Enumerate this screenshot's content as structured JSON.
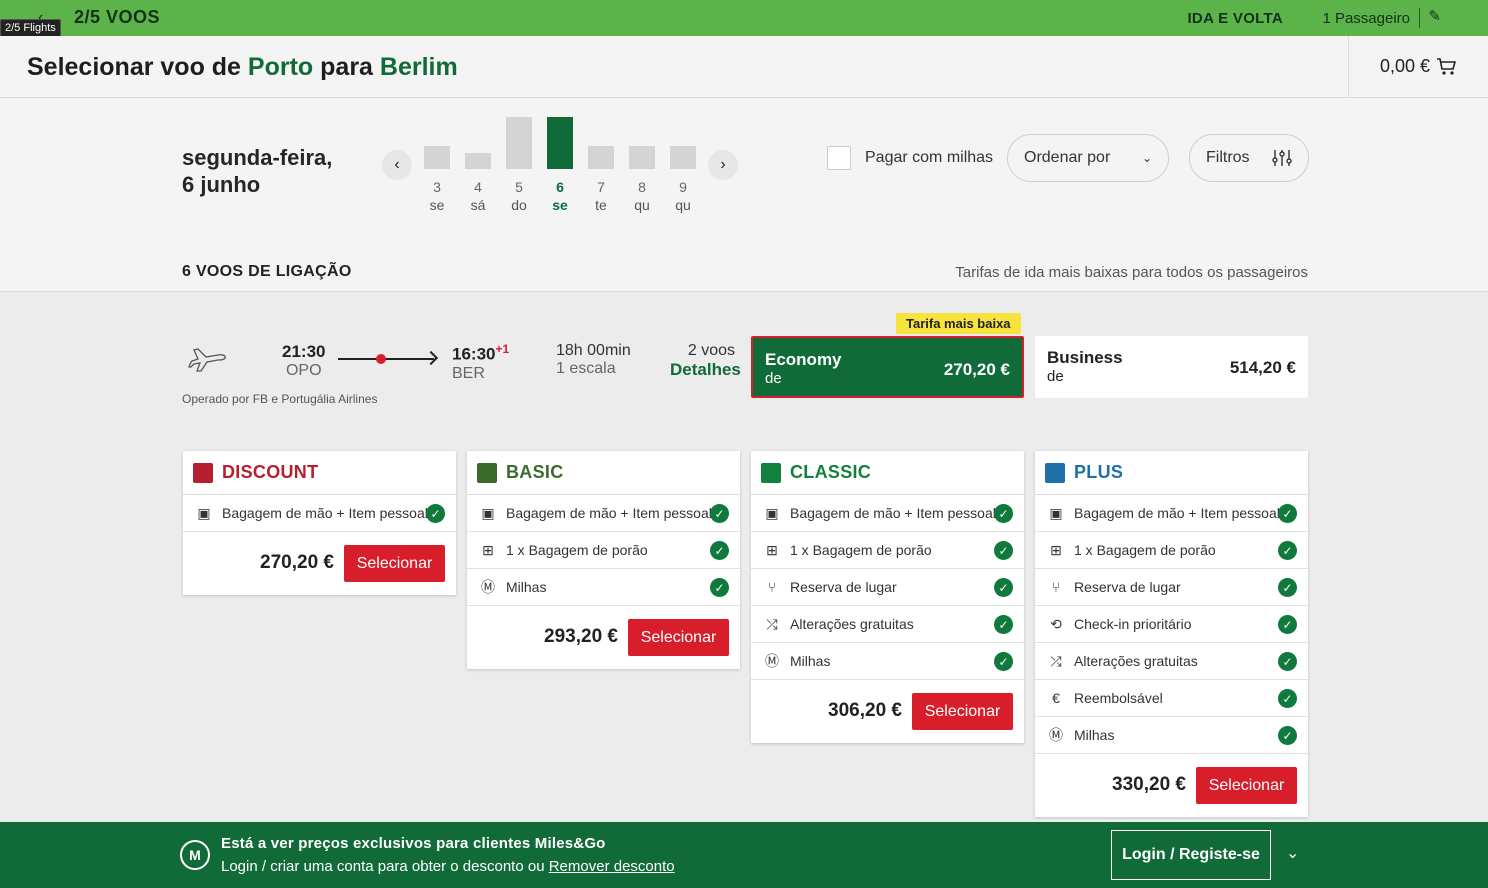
{
  "topbar": {
    "back_icon": "chevron-left-icon",
    "step": "2/5 VOOS",
    "tooltip": "2/5 Flights",
    "trip_type": "IDA E VOLTA",
    "passengers": "1 Passageiro",
    "edit_icon": "pencil-icon",
    "bg_color": "#5cb349"
  },
  "header": {
    "title_prefix": "Selecionar voo de",
    "origin": "Porto",
    "connector": "para",
    "destination": "Berlim",
    "cart_total": "0,00 €",
    "cart_icon": "cart-icon"
  },
  "date_selector": {
    "selected_label_line1": "segunda-feira,",
    "selected_label_line2": "6 junho",
    "days": [
      {
        "num": "3",
        "wd": "se",
        "level": 0.45
      },
      {
        "num": "4",
        "wd": "sá",
        "level": 0.3
      },
      {
        "num": "5",
        "wd": "do",
        "level": 1.0
      },
      {
        "num": "6",
        "wd": "se",
        "level": 1.0,
        "selected": true
      },
      {
        "num": "7",
        "wd": "te",
        "level": 0.45
      },
      {
        "num": "8",
        "wd": "qu",
        "level": 0.45
      },
      {
        "num": "9",
        "wd": "qu",
        "level": 0.45
      }
    ]
  },
  "controls": {
    "pay_with_miles": "Pagar com milhas",
    "sort_label": "Ordenar por",
    "filters_label": "Filtros"
  },
  "results": {
    "count": "6 VOOS DE LIGAÇÃO",
    "note": "Tarifas de ida mais baixas para todos os passageiros"
  },
  "flight": {
    "dep_time": "21:30",
    "dep_code": "OPO",
    "arr_time": "16:30",
    "arr_offset": "+1",
    "arr_code": "BER",
    "duration": "18h 00min",
    "stops": "1 escala",
    "segments": "2 voos",
    "details": "Detalhes",
    "operated_by": "Operado por FB e Portugália Airlines",
    "lowest_tag": "Tarifa mais baixa",
    "cabins": [
      {
        "name": "Economy",
        "from": "de",
        "price": "270,20 €"
      },
      {
        "name": "Business",
        "from": "de",
        "price": "514,20 €"
      }
    ]
  },
  "fares": [
    {
      "name": "DISCOUNT",
      "color": "#b51f2e",
      "logo": "ttt",
      "features": [
        {
          "icon": "carry-on-icon",
          "label": "Bagagem de mão + Item pessoal"
        }
      ],
      "price": "270,20 €",
      "button": "Selecionar"
    },
    {
      "name": "BASIC",
      "color": "#3a6b2c",
      "logo": "b",
      "features": [
        {
          "icon": "carry-on-icon",
          "label": "Bagagem de mão + Item pessoal"
        },
        {
          "icon": "checked-bag-icon",
          "label": "1 x Bagagem de porão"
        },
        {
          "icon": "miles-icon",
          "label": "Milhas"
        }
      ],
      "price": "293,20 €",
      "button": "Selecionar"
    },
    {
      "name": "CLASSIC",
      "color": "#14803d",
      "logo": "C",
      "features": [
        {
          "icon": "carry-on-icon",
          "label": "Bagagem de mão + Item pessoal"
        },
        {
          "icon": "checked-bag-icon",
          "label": "1 x Bagagem de porão"
        },
        {
          "icon": "seat-icon",
          "label": "Reserva de lugar"
        },
        {
          "icon": "shuffle-icon",
          "label": "Alterações gratuitas"
        },
        {
          "icon": "miles-icon",
          "label": "Milhas"
        }
      ],
      "price": "306,20 €",
      "button": "Selecionar"
    },
    {
      "name": "PLUS",
      "color": "#1f6fa8",
      "logo": "+",
      "features": [
        {
          "icon": "carry-on-icon",
          "label": "Bagagem de mão + Item pessoal"
        },
        {
          "icon": "checked-bag-icon",
          "label": "1 x Bagagem de porão"
        },
        {
          "icon": "seat-icon",
          "label": "Reserva de lugar"
        },
        {
          "icon": "priority-checkin-icon",
          "label": "Check-in prioritário"
        },
        {
          "icon": "shuffle-icon",
          "label": "Alterações gratuitas"
        },
        {
          "icon": "refund-icon",
          "label": "Reembolsável"
        },
        {
          "icon": "miles-icon",
          "label": "Milhas"
        }
      ],
      "price": "330,20 €",
      "button": "Selecionar"
    }
  ],
  "banner": {
    "title": "Está a ver preços exclusivos para clientes Miles&Go",
    "text": "Login / criar uma conta para obter o desconto ou",
    "link": "Remover desconto",
    "login_button": "Login / Registe-se",
    "icon": "miles-and-go-icon"
  }
}
